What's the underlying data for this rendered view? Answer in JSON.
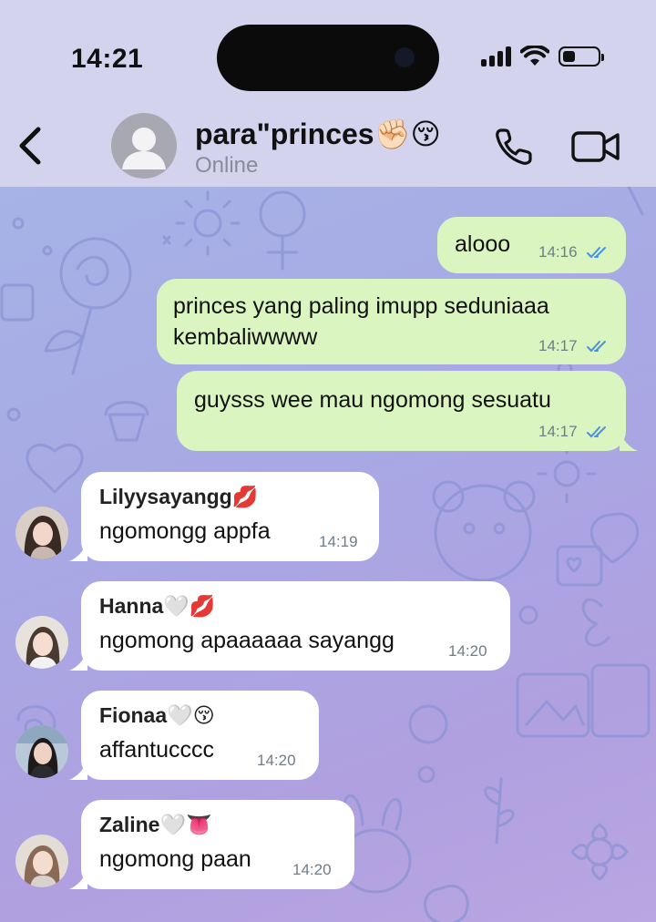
{
  "status_bar": {
    "time": "14:21",
    "battery_level": 0.35,
    "icons": [
      "signal-icon",
      "wifi-icon",
      "battery-icon"
    ]
  },
  "header": {
    "title": "para\"princes✊🏻😚",
    "status": "Online",
    "icons": {
      "back": "back-chevron-icon",
      "call": "phone-icon",
      "video": "video-camera-icon"
    }
  },
  "messages": [
    {
      "direction": "out",
      "text": "alooo",
      "time": "14:16",
      "read": true
    },
    {
      "direction": "out",
      "text_lines": [
        "princes yang paling imupp seduniaaa",
        "kembaliwwww"
      ],
      "time": "14:17",
      "read": true
    },
    {
      "direction": "out",
      "text": "guysss wee mau ngomong sesuatu",
      "time": "14:17",
      "read": true
    },
    {
      "direction": "in",
      "sender": "Lilyysayangg💋",
      "text": "ngomongg appfa",
      "time": "14:19"
    },
    {
      "direction": "in",
      "sender": "Hanna🤍💋",
      "text": "ngomong apaaaaaa sayangg",
      "time": "14:20"
    },
    {
      "direction": "in",
      "sender": "Fionaa🤍😚",
      "text": "affantucccc",
      "time": "14:20"
    },
    {
      "direction": "in",
      "sender": "Zaline🤍👅",
      "text": "ngomong paan",
      "time": "14:20"
    }
  ],
  "colors": {
    "outgoing_bubble": "#dbf5c0",
    "incoming_bubble": "#ffffff",
    "read_ticks": "#4a90e2",
    "header_bg": "#d4d3ee"
  }
}
